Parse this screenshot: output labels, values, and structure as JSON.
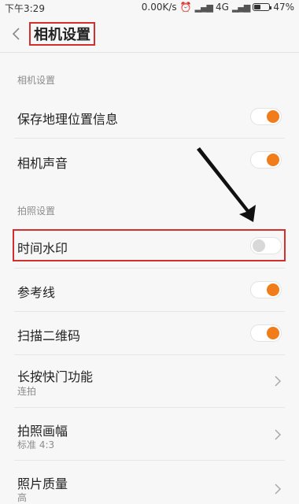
{
  "status": {
    "time": "下午3:29",
    "speed": "0.00K/s",
    "network": "4G",
    "battery": "47%",
    "battery_level": 0.47
  },
  "header": {
    "title": "相机设置"
  },
  "sections": [
    {
      "title": "相机设置",
      "rows": [
        {
          "label": "保存地理位置信息",
          "type": "toggle",
          "on": true
        },
        {
          "label": "相机声音",
          "type": "toggle",
          "on": true
        }
      ]
    },
    {
      "title": "拍照设置",
      "rows": [
        {
          "label": "时间水印",
          "type": "toggle",
          "on": false
        },
        {
          "label": "参考线",
          "type": "toggle",
          "on": true
        },
        {
          "label": "扫描二维码",
          "type": "toggle",
          "on": true
        },
        {
          "label": "长按快门功能",
          "value": "连拍",
          "type": "nav"
        },
        {
          "label": "拍照画幅",
          "value": "标准 4:3",
          "type": "nav"
        },
        {
          "label": "照片质量",
          "value": "高",
          "type": "nav"
        }
      ]
    }
  ],
  "colors": {
    "accent": "#f07d1a",
    "highlight_box": "#d32f2f"
  },
  "icons": [
    "back-chevron-icon",
    "alarm-icon",
    "signal-icon",
    "battery-icon",
    "chevron-right-icon",
    "arrow-annotation"
  ]
}
